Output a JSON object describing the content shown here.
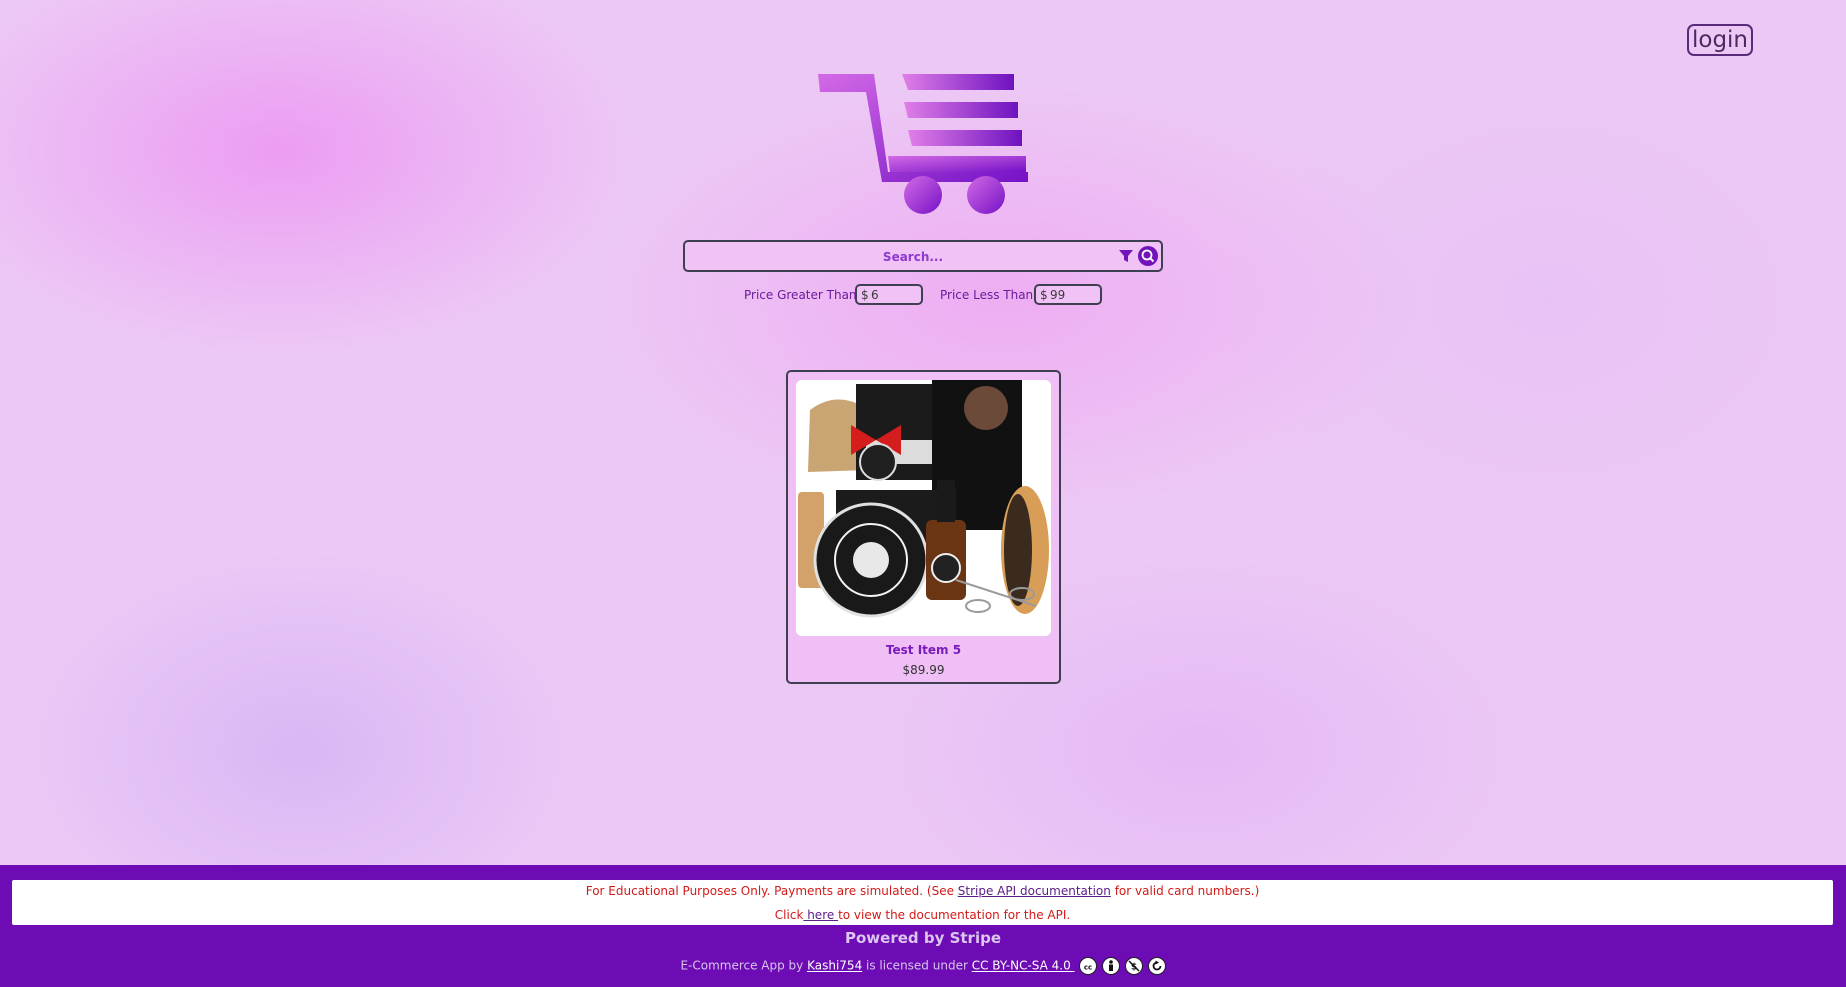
{
  "header": {
    "login_label": "login"
  },
  "search": {
    "placeholder": "Search..."
  },
  "price_filter": {
    "greater_label": "Price Greater Than:",
    "greater_currency": "$",
    "greater_value": "6",
    "less_label": "Price Less Than:",
    "less_currency": "$",
    "less_value": "99"
  },
  "products": [
    {
      "name": "Test Item 5",
      "price": "$89.99"
    }
  ],
  "footer": {
    "notice_prefix": "For Educational Purposes Only. Payments are simulated. (See ",
    "notice_link": "Stripe API documentation",
    "notice_suffix": " for valid card numbers.)",
    "docs_prefix": "Click",
    "docs_link": " here ",
    "docs_suffix": "to view the documentation for the API.",
    "powered_by": "Powered by Stripe",
    "credit_prefix": "E-Commerce App by ",
    "credit_author": "Kashi754",
    "credit_mid": " is licensed under ",
    "credit_license": "CC BY-NC-SA 4.0 "
  },
  "colors": {
    "brand_purple": "#6d0cb4",
    "accent_violet": "#7213b9",
    "warning_red": "#d21a1a"
  },
  "icons": [
    "cart-logo-icon",
    "filter-icon",
    "search-icon",
    "cc-icon",
    "by-icon",
    "nc-icon",
    "sa-icon"
  ]
}
